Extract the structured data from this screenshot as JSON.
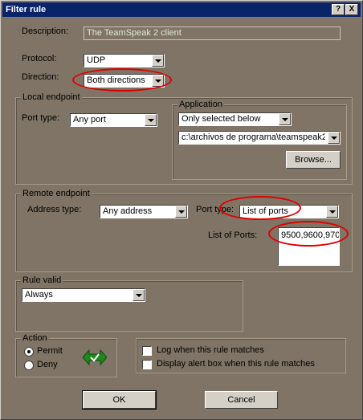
{
  "window": {
    "title": "Filter rule",
    "help_label": "?",
    "close_label": "X"
  },
  "description": {
    "label": "Description:",
    "value": "The TeamSpeak 2 client"
  },
  "protocol": {
    "label": "Protocol:",
    "value": "UDP"
  },
  "direction": {
    "label": "Direction:",
    "value": "Both directions"
  },
  "local_endpoint": {
    "title": "Local endpoint",
    "port_type_label": "Port type:",
    "port_type_value": "Any port",
    "application": {
      "title": "Application",
      "mode_value": "Only selected below",
      "path_value": "c:\\archivos de programa\\teamspeak2",
      "browse_label": "Browse..."
    }
  },
  "remote_endpoint": {
    "title": "Remote endpoint",
    "address_type_label": "Address type:",
    "address_type_value": "Any address",
    "port_type_label": "Port type:",
    "port_type_value": "List of ports",
    "list_of_ports_label": "List of Ports:",
    "list_of_ports_value": "9500,9600,970"
  },
  "rule_valid": {
    "title": "Rule valid",
    "value": "Always"
  },
  "action": {
    "title": "Action",
    "permit_label": "Permit",
    "deny_label": "Deny",
    "selected": "Permit"
  },
  "options": {
    "log_label": "Log when this rule matches",
    "log_checked": false,
    "alert_label": "Display alert box when this rule matches",
    "alert_checked": false
  },
  "buttons": {
    "ok_label": "OK",
    "cancel_label": "Cancel"
  },
  "colors": {
    "dialog_bg": "#7f7465",
    "titlebar": "#0a246a",
    "highlight_ellipse": "#e00000",
    "permit_icon": "#1e8a1e"
  }
}
